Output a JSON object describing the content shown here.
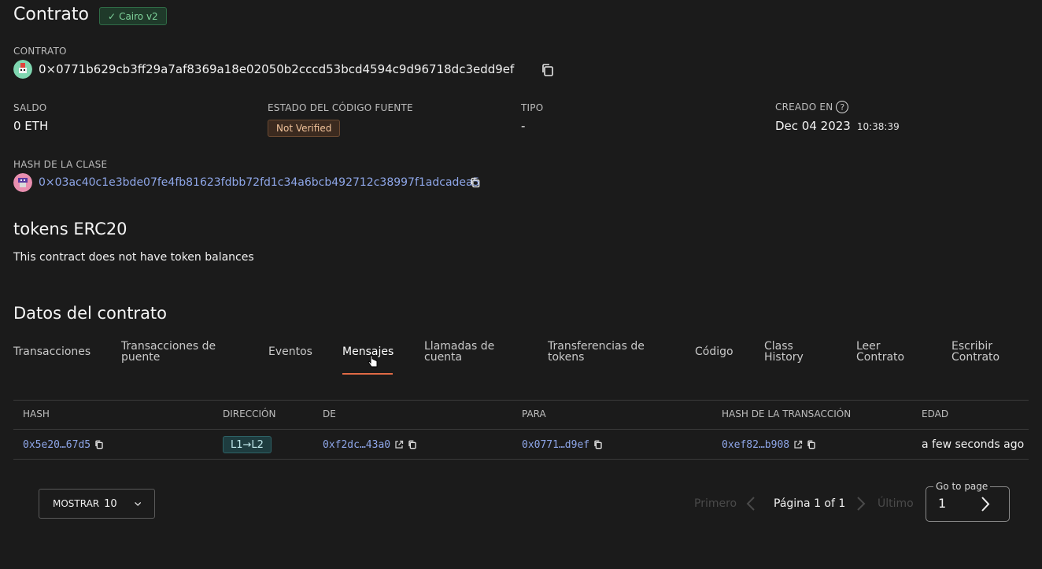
{
  "header": {
    "title": "Contrato",
    "badge": "Cairo v2"
  },
  "contract": {
    "label": "CONTRATO",
    "address": "0×0771b629cb3ff29a7af8369a18e02050b2cccd53bcd4594c9d96718dc3edd9ef"
  },
  "stats": {
    "saldo_label": "SALDO",
    "saldo_value": "0 ETH",
    "estado_label": "ESTADO DEL CÓDIGO FUENTE",
    "estado_value": "Not Verified",
    "tipo_label": "TIPO",
    "tipo_value": "-",
    "creado_label": "CREADO EN",
    "creado_date": "Dec 04 2023",
    "creado_time": "10:38:39"
  },
  "class_hash": {
    "label": "HASH DE LA CLASE",
    "value": "0×03ac40c1e3bde07fe4fb81623fdbb72fd1c34a6bcb492712c38997f1adcadea5"
  },
  "tokens": {
    "title": "tokens ERC20",
    "empty_text": "This contract does not have token balances"
  },
  "contract_data": {
    "title": "Datos del contrato",
    "tabs": [
      {
        "line1": "Transacciones",
        "line2": ""
      },
      {
        "line1": "Transacciones de",
        "line2": "puente"
      },
      {
        "line1": "Eventos",
        "line2": ""
      },
      {
        "line1": "Mensajes",
        "line2": ""
      },
      {
        "line1": "Llamadas de",
        "line2": "cuenta"
      },
      {
        "line1": "Transferencias de",
        "line2": "tokens"
      },
      {
        "line1": "Código",
        "line2": ""
      },
      {
        "line1": "Class",
        "line2": "History"
      },
      {
        "line1": "Leer",
        "line2": "Contrato"
      },
      {
        "line1": "Escribir",
        "line2": "Contrato"
      }
    ]
  },
  "table": {
    "headers": [
      "HASH",
      "DIRECCIÓN",
      "DE",
      "PARA",
      "HASH DE LA TRANSACCIÓN",
      "EDAD"
    ],
    "row": {
      "hash": "0x5e20…67d5",
      "direction": "L1→L2",
      "from": "0xf2dc…43a0",
      "to": "0x0771…d9ef",
      "tx_hash": "0xef82…b908",
      "age": "a few seconds ago"
    }
  },
  "pagination": {
    "show_label": "MOSTRAR",
    "show_value": "10",
    "first": "Primero",
    "page_text": "Página 1 of 1",
    "last": "Último",
    "goto_label": "Go to page",
    "goto_value": "1"
  }
}
